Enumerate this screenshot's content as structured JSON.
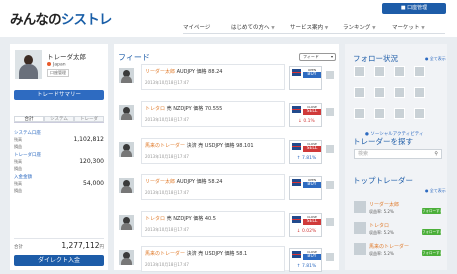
{
  "header": {
    "logo_prefix": "みんなの",
    "logo_brand": "シストレ",
    "account_button": "口座管理",
    "nav": [
      {
        "label": "マイページ"
      },
      {
        "label": "はじめての方へ"
      },
      {
        "label": "サービス案内"
      },
      {
        "label": "ランキング"
      },
      {
        "label": "マーケット"
      }
    ],
    "nav_arrow": "▼"
  },
  "profile": {
    "name": "トレーダ太郎",
    "country": "Japan",
    "tag": "口座管理",
    "summary_button": "トレードサマリー",
    "tabs": [
      "合計",
      "システム",
      "トレーダ"
    ],
    "stats": [
      {
        "label": "システム口座",
        "rows": [
          {
            "k": "残高",
            "v": "1,102,812"
          },
          {
            "k": "損益",
            "v": ""
          }
        ]
      },
      {
        "label": "トレーダ口座",
        "rows": [
          {
            "k": "残高",
            "v": "120,300"
          },
          {
            "k": "損益",
            "v": ""
          }
        ]
      },
      {
        "label": "入金金額",
        "rows": [
          {
            "k": "残高",
            "v": "54,000"
          },
          {
            "k": "損益",
            "v": ""
          }
        ]
      }
    ],
    "total_label": "合計",
    "total_value": "1,277,112",
    "total_unit": "円",
    "deposit_button": "ダイレクト入金"
  },
  "feed": {
    "title": "フィード",
    "filter": "フィード",
    "posts": [
      {
        "name": "リーダー太郎",
        "body": " AUDJPY 価格 88.24",
        "time": "2013年10月18日17:47",
        "status": "OPEN",
        "side": "BUY",
        "side_class": "side-buy",
        "pct": "",
        "pct_class": "pct-pos"
      },
      {
        "name": "トレタロ",
        "body": " 売 NZDJPY 価格 70.555",
        "time": "2013年10月18日17:47",
        "status": "CLOSE",
        "side": "SELL",
        "side_class": "side-sell",
        "pct": "↓ 0.1%",
        "pct_class": "pct-neg"
      },
      {
        "name": "馬来のトレーダー",
        "body": " 決済 売 USDJPY 価格 98.101",
        "time": "2013年10月18日17:47",
        "status": "CLOSE",
        "side": "SELL",
        "side_class": "side-sell",
        "pct": "↑ 7.81%",
        "pct_class": "pct-pos"
      },
      {
        "name": "リーダー太郎",
        "body": " AUDJPY 価格 58.24",
        "time": "2013年10月18日17:47",
        "status": "OPEN",
        "side": "BUY",
        "side_class": "side-buy",
        "pct": "",
        "pct_class": "pct-pos"
      },
      {
        "name": "トレタロ",
        "body": " 売 NZDJPY 価格 40.5",
        "time": "2013年10月18日17:47",
        "status": "CLOSE",
        "side": "SELL",
        "side_class": "side-sell",
        "pct": "↓ 0.02%",
        "pct_class": "pct-neg"
      },
      {
        "name": "馬来のトレーダー",
        "body": " 決済 売 USDJPY 価格 58.1",
        "time": "2013年10月18日17:47",
        "status": "CLOSE",
        "side": "BUY",
        "side_class": "side-buy",
        "pct": "↑ 7.81%",
        "pct_class": "pct-pos"
      }
    ]
  },
  "sidebar": {
    "follow_title": "フォロー状況",
    "more": "● 全て表示",
    "social_link": "● ソーシャルアクティビティ",
    "search_title": "トレーダーを探す",
    "search_placeholder": "検索",
    "top_title": "トップトレーダー",
    "follow_label": "フォローする",
    "leaders": [
      {
        "name": "リーダー太郎",
        "rate": "収益率: 5.2%"
      },
      {
        "name": "トレタロ",
        "rate": "収益率: 5.2%"
      },
      {
        "name": "馬来のトレーダー",
        "rate": "収益率: 5.2%"
      }
    ]
  }
}
